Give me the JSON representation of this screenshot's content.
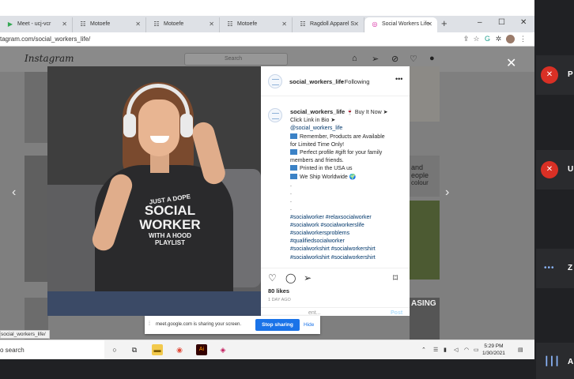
{
  "browser": {
    "tabs": [
      {
        "label": "Meet - ucj-vcr",
        "icon": "meet-icon",
        "active": false
      },
      {
        "label": "Motoefe",
        "icon": "motoefe-icon",
        "active": false
      },
      {
        "label": "Motoefe",
        "icon": "motoefe-icon",
        "active": false
      },
      {
        "label": "Motoefe",
        "icon": "motoefe-icon",
        "active": false
      },
      {
        "label": "Ragdoll Apparel S",
        "icon": "motoefe-icon",
        "active": false
      },
      {
        "label": "Social Workers Life",
        "icon": "instagram-icon",
        "active": true
      }
    ],
    "new_tab": "+",
    "window_controls": {
      "minimize": "–",
      "maximize": "☐",
      "close": "✕"
    },
    "url": "tagram.com/social_workers_life/"
  },
  "instagram": {
    "logo": "Instagram",
    "search_placeholder": "Search"
  },
  "post": {
    "username": "social_workers_life",
    "follow_state": "• Following",
    "more": "•••",
    "caption_lines": [
      {
        "text": "🍷 Buy It Now ➤",
        "type": "first"
      },
      {
        "text": "Click Link in Bio ➤",
        "type": "text"
      },
      {
        "text": "@social_workers_life",
        "type": "link"
      },
      {
        "text": "Remember, Products are Available",
        "type": "box"
      },
      {
        "text": "for Limited Time Only!",
        "type": "text"
      },
      {
        "text": "Perfect profile #gift for your family",
        "type": "box"
      },
      {
        "text": "members and friends.",
        "type": "text"
      },
      {
        "text": "Printed in the USA us",
        "type": "box"
      },
      {
        "text": "We Ship Worldwide 🌍",
        "type": "box"
      },
      {
        "text": ".",
        "type": "text"
      },
      {
        "text": ".",
        "type": "text"
      },
      {
        "text": ".",
        "type": "text"
      },
      {
        "text": ".",
        "type": "text"
      },
      {
        "text": "#socialworker #relaxsocialworker",
        "type": "link"
      },
      {
        "text": "#socialwork #socialworkerslife",
        "type": "link"
      },
      {
        "text": "#socialworkersproblems",
        "type": "link"
      },
      {
        "text": "#qualifiedsocialworker",
        "type": "link"
      },
      {
        "text": "#socialworkshirt #socialworkershirt",
        "type": "link"
      },
      {
        "text": "#socialworkshirt #socialworkershirt",
        "type": "link"
      }
    ],
    "likes": "80 likes",
    "time_ago": "1 DAY AGO",
    "comment_placeholder": "ent...",
    "post_button": "Post",
    "shirt_lines": [
      "JUST A DOPE",
      "SOCIAL",
      "WORKER",
      "WITH A HOOD",
      "PLAYLIST"
    ]
  },
  "background_tiles": {
    "right_labels": [
      "and",
      "eople",
      "colour",
      "ASING"
    ]
  },
  "share_banner": {
    "text": "meet.google.com is sharing your screen.",
    "stop": "Stop sharing",
    "hide": "Hide"
  },
  "status_url": "social_workers_life/",
  "taskbar": {
    "search": "o search",
    "time": "5:29 PM",
    "date": "1/30/2021"
  },
  "meet_panel": {
    "participants": [
      {
        "initial": "P",
        "muted": true
      },
      {
        "initial": "U",
        "muted": true
      },
      {
        "initial": "Z",
        "muted": false
      },
      {
        "initial": "A",
        "muted": false
      }
    ]
  }
}
